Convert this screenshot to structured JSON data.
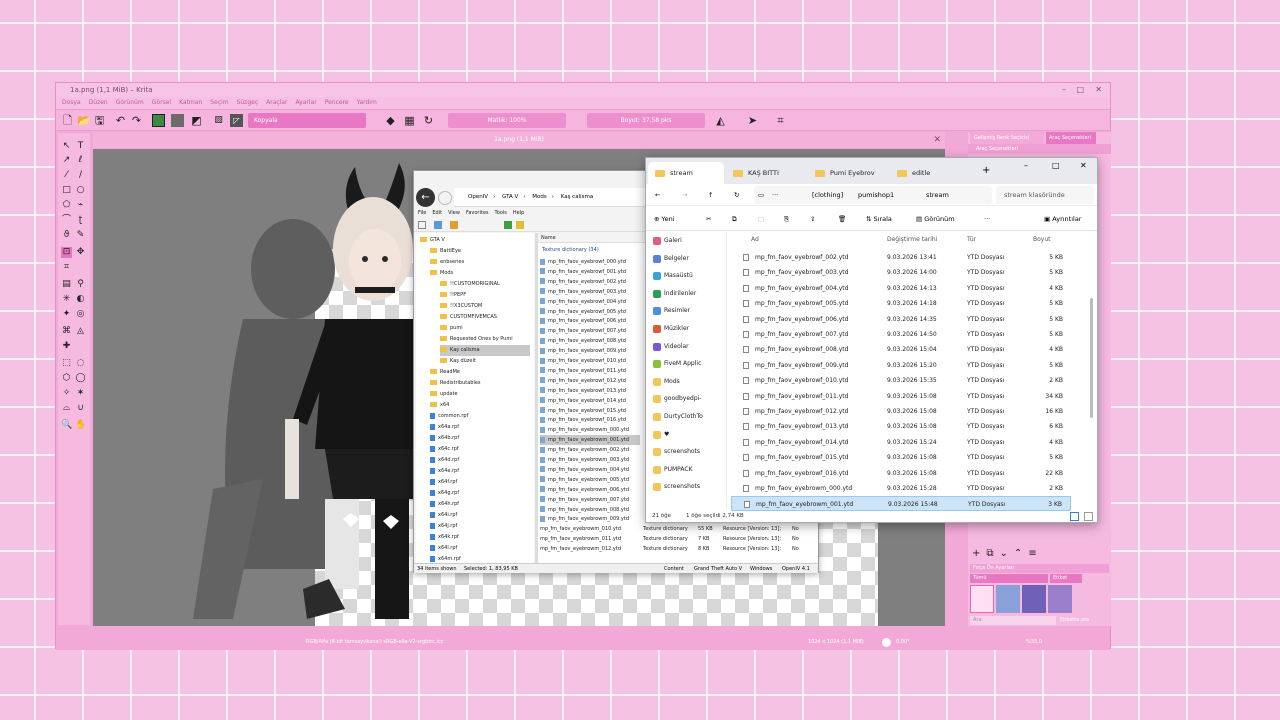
{
  "krita": {
    "title": "1a.png (1,1 MiB) – Krita",
    "menu": [
      "Dosya",
      "Düzen",
      "Görünüm",
      "Görsel",
      "Katman",
      "Seçim",
      "Süzgeç",
      "Araçlar",
      "Ayarlar",
      "Pencere",
      "Yardım"
    ],
    "blend_mode": "Kopyala",
    "opacity": "Matlık: 100%",
    "size": "Boyut: 37,58 pks",
    "doc_tab": "1a.png (1,1 MiB)",
    "right_tabs": [
      "Gelişmiş Renk Seçicisi",
      "Araç Seçenekleri"
    ],
    "right_sub": "Araç Seçenekleri",
    "presets_title": "Fırça Ön Ayarları",
    "presets_filter": "Tümü",
    "presets_tag": "Etiket",
    "presets_search": "Ara",
    "presets_filter_check": "Etikette ara",
    "status_left": "RGB/Alfa (8-bit tamsayı/kanal) sRGB-elle-V2-srgbtrc.icc",
    "status_size": "1024 x 1024 (1,1 MiB)",
    "zoom": "0,00°",
    "zoom_pct": "%33,0"
  },
  "openiv": {
    "path": [
      "OpenIV",
      "GTA V",
      "Mods",
      "Kaş calisma"
    ],
    "menu": [
      "File",
      "Edit",
      "View",
      "Favorites",
      "Tools",
      "Help"
    ],
    "tree": [
      {
        "label": "GTA V",
        "type": "folder",
        "indent": 0
      },
      {
        "label": "BattlEye",
        "type": "folder",
        "indent": 1
      },
      {
        "label": "enbseries",
        "type": "folder",
        "indent": 1
      },
      {
        "label": "Mods",
        "type": "folder",
        "indent": 1
      },
      {
        "label": "!!CUSTOMORIGINAL",
        "type": "folder",
        "indent": 2
      },
      {
        "label": "!!PEPF",
        "type": "folder",
        "indent": 2
      },
      {
        "label": "!!X3CUSTOM",
        "type": "folder",
        "indent": 2
      },
      {
        "label": "CUSTOMFIVEMCAS",
        "type": "folder",
        "indent": 2
      },
      {
        "label": "pumi",
        "type": "folder",
        "indent": 2
      },
      {
        "label": "Requested Ones by Pumi",
        "type": "folder",
        "indent": 2
      },
      {
        "label": "Kaş calisma",
        "type": "folder",
        "indent": 2,
        "selected": true
      },
      {
        "label": "Kaş düzelt",
        "type": "folder",
        "indent": 2
      },
      {
        "label": "ReadMe",
        "type": "folder",
        "indent": 1
      },
      {
        "label": "Redistributables",
        "type": "folder",
        "indent": 1
      },
      {
        "label": "update",
        "type": "folder",
        "indent": 1
      },
      {
        "label": "x64",
        "type": "folder",
        "indent": 1
      },
      {
        "label": "common.rpf",
        "type": "file",
        "indent": 1
      },
      {
        "label": "x64a.rpf",
        "type": "file",
        "indent": 1
      },
      {
        "label": "x64b.rpf",
        "type": "file",
        "indent": 1
      },
      {
        "label": "x64c.rpf",
        "type": "file",
        "indent": 1
      },
      {
        "label": "x64d.rpf",
        "type": "file",
        "indent": 1
      },
      {
        "label": "x64e.rpf",
        "type": "file",
        "indent": 1
      },
      {
        "label": "x64f.rpf",
        "type": "file",
        "indent": 1
      },
      {
        "label": "x64g.rpf",
        "type": "file",
        "indent": 1
      },
      {
        "label": "x64h.rpf",
        "type": "file",
        "indent": 1
      },
      {
        "label": "x64i.rpf",
        "type": "file",
        "indent": 1
      },
      {
        "label": "x64j.rpf",
        "type": "file",
        "indent": 1
      },
      {
        "label": "x64k.rpf",
        "type": "file",
        "indent": 1
      },
      {
        "label": "x64l.rpf",
        "type": "file",
        "indent": 1
      },
      {
        "label": "x64m.rpf",
        "type": "file",
        "indent": 1
      }
    ],
    "col_name": "Name",
    "group": "Texture dictionary (34)",
    "files": [
      "mp_fm_faov_eyebrowf_000.ytd",
      "mp_fm_faov_eyebrowf_001.ytd",
      "mp_fm_faov_eyebrowf_002.ytd",
      "mp_fm_faov_eyebrowf_003.ytd",
      "mp_fm_faov_eyebrowf_004.ytd",
      "mp_fm_faov_eyebrowf_005.ytd",
      "mp_fm_faov_eyebrowf_006.ytd",
      "mp_fm_faov_eyebrowf_007.ytd",
      "mp_fm_faov_eyebrowf_008.ytd",
      "mp_fm_faov_eyebrowf_009.ytd",
      "mp_fm_faov_eyebrowf_010.ytd",
      "mp_fm_faov_eyebrowf_011.ytd",
      "mp_fm_faov_eyebrowf_012.ytd",
      "mp_fm_faov_eyebrowf_013.ytd",
      "mp_fm_faov_eyebrowf_014.ytd",
      "mp_fm_faov_eyebrowf_015.ytd",
      "mp_fm_faov_eyebrowf_016.ytd",
      "mp_fm_faov_eyebrowm_000.ytd",
      "mp_fm_faov_eyebrowm_001.ytd",
      "mp_fm_faov_eyebrowm_002.ytd",
      "mp_fm_faov_eyebrowm_003.ytd",
      "mp_fm_faov_eyebrowm_004.ytd",
      "mp_fm_faov_eyebrowm_005.ytd",
      "mp_fm_faov_eyebrowm_006.ytd",
      "mp_fm_faov_eyebrowm_007.ytd",
      "mp_fm_faov_eyebrowm_008.ytd",
      "mp_fm_faov_eyebrowm_009.ytd"
    ],
    "detail_rows": [
      {
        "name": "mp_fm_faov_eyebrowm_010.ytd",
        "type": "Texture dictionary",
        "size": "55 KB",
        "res": "Resource [Version: 13];",
        "comp": "No"
      },
      {
        "name": "mp_fm_faov_eyebrowm_011.ytd",
        "type": "Texture dictionary",
        "size": "7 KB",
        "res": "Resource [Version: 13];",
        "comp": "No"
      },
      {
        "name": "mp_fm_faov_eyebrowm_012.ytd",
        "type": "Texture dictionary",
        "size": "8 KB",
        "res": "Resource [Version: 13];",
        "comp": "No"
      }
    ],
    "status": {
      "items": "34 items shown",
      "selected": "Selected: 1,  83,95 KB",
      "content": "Content",
      "game": "Grand Theft Auto V",
      "os": "Windows",
      "version": "OpenIV 4.1"
    }
  },
  "explorer": {
    "tabs": [
      "stream",
      "KAŞ BITTI",
      "Pumi Eyebrov",
      "editle"
    ],
    "breadcrumb": [
      "[clothing]",
      "pumishop1",
      "stream"
    ],
    "search_placeholder": "stream klasöründe",
    "cmd": {
      "new": "Yeni",
      "sort": "Sırala",
      "view": "Görünüm",
      "details": "Ayrıntılar"
    },
    "sidebar": [
      {
        "label": "Galeri",
        "color": "#e05b8a"
      },
      {
        "label": "Belgeler",
        "color": "#5a7fd6"
      },
      {
        "label": "Masaüstü",
        "color": "#3ea0d9"
      },
      {
        "label": "İndirilenler",
        "color": "#2a9d5a"
      },
      {
        "label": "Resimler",
        "color": "#4c8fdb"
      },
      {
        "label": "Müzikler",
        "color": "#e0583e"
      },
      {
        "label": "Videolar",
        "color": "#7b56d8"
      },
      {
        "label": "FiveM Applic",
        "color": "#8dbf3c"
      },
      {
        "label": "Mods",
        "color": "#f1c65a"
      },
      {
        "label": "goodbyedpi-",
        "color": "#f1c65a"
      },
      {
        "label": "DurtyClothTo",
        "color": "#f1c65a"
      },
      {
        "label": "♥",
        "color": "#f1c65a"
      },
      {
        "label": "screenshots",
        "color": "#f1c65a"
      },
      {
        "label": "PUMPACK",
        "color": "#f1c65a"
      },
      {
        "label": "screenshots",
        "color": "#f1c65a"
      }
    ],
    "columns": {
      "name": "Ad",
      "date": "Değiştirme tarihi",
      "type": "Tür",
      "size": "Boyut"
    },
    "rows": [
      {
        "name": "mp_fm_faov_eyebrowf_002.ytd",
        "date": "9.03.2026 13:41",
        "type": "YTD Dosyası",
        "size": "5 KB"
      },
      {
        "name": "mp_fm_faov_eyebrowf_003.ytd",
        "date": "9.03.2026 14:00",
        "type": "YTD Dosyası",
        "size": "5 KB"
      },
      {
        "name": "mp_fm_faov_eyebrowf_004.ytd",
        "date": "9.03.2026 14:13",
        "type": "YTD Dosyası",
        "size": "4 KB"
      },
      {
        "name": "mp_fm_faov_eyebrowf_005.ytd",
        "date": "9.03.2026 14:18",
        "type": "YTD Dosyası",
        "size": "5 KB"
      },
      {
        "name": "mp_fm_faov_eyebrowf_006.ytd",
        "date": "9.03.2026 14:35",
        "type": "YTD Dosyası",
        "size": "5 KB"
      },
      {
        "name": "mp_fm_faov_eyebrowf_007.ytd",
        "date": "9.03.2026 14:50",
        "type": "YTD Dosyası",
        "size": "5 KB"
      },
      {
        "name": "mp_fm_faov_eyebrowf_008.ytd",
        "date": "9.03.2026 15:04",
        "type": "YTD Dosyası",
        "size": "4 KB"
      },
      {
        "name": "mp_fm_faov_eyebrowf_009.ytd",
        "date": "9.03.2026 15:20",
        "type": "YTD Dosyası",
        "size": "5 KB"
      },
      {
        "name": "mp_fm_faov_eyebrowf_010.ytd",
        "date": "9.03.2026 15:35",
        "type": "YTD Dosyası",
        "size": "2 KB"
      },
      {
        "name": "mp_fm_faov_eyebrowf_011.ytd",
        "date": "9.03.2026 15:08",
        "type": "YTD Dosyası",
        "size": "34 KB"
      },
      {
        "name": "mp_fm_faov_eyebrowf_012.ytd",
        "date": "9.03.2026 15:08",
        "type": "YTD Dosyası",
        "size": "16 KB"
      },
      {
        "name": "mp_fm_faov_eyebrowf_013.ytd",
        "date": "9.03.2026 15:08",
        "type": "YTD Dosyası",
        "size": "6 KB"
      },
      {
        "name": "mp_fm_faov_eyebrowf_014.ytd",
        "date": "9.03.2026 15:24",
        "type": "YTD Dosyası",
        "size": "4 KB"
      },
      {
        "name": "mp_fm_faov_eyebrowf_015.ytd",
        "date": "9.03.2026 15:08",
        "type": "YTD Dosyası",
        "size": "5 KB"
      },
      {
        "name": "mp_fm_faov_eyebrowf_016.ytd",
        "date": "9.03.2026 15:08",
        "type": "YTD Dosyası",
        "size": "22 KB"
      },
      {
        "name": "mp_fm_faov_eyebrowm_000.ytd",
        "date": "9.03.2026 15:28",
        "type": "YTD Dosyası",
        "size": "2 KB"
      },
      {
        "name": "mp_fm_faov_eyebrowm_001.ytd",
        "date": "9.03.2026 15:48",
        "type": "YTD Dosyası",
        "size": "3 KB",
        "selected": true
      }
    ],
    "status": {
      "count": "21 öğe",
      "selected": "1 öğe seçildi  2,74 KB"
    }
  },
  "colors": {
    "pink_bg": "#f6c2e4",
    "krita_frame": "#f3a9d8",
    "accent": "#e879c6",
    "selected_row": "#cce4f7"
  }
}
